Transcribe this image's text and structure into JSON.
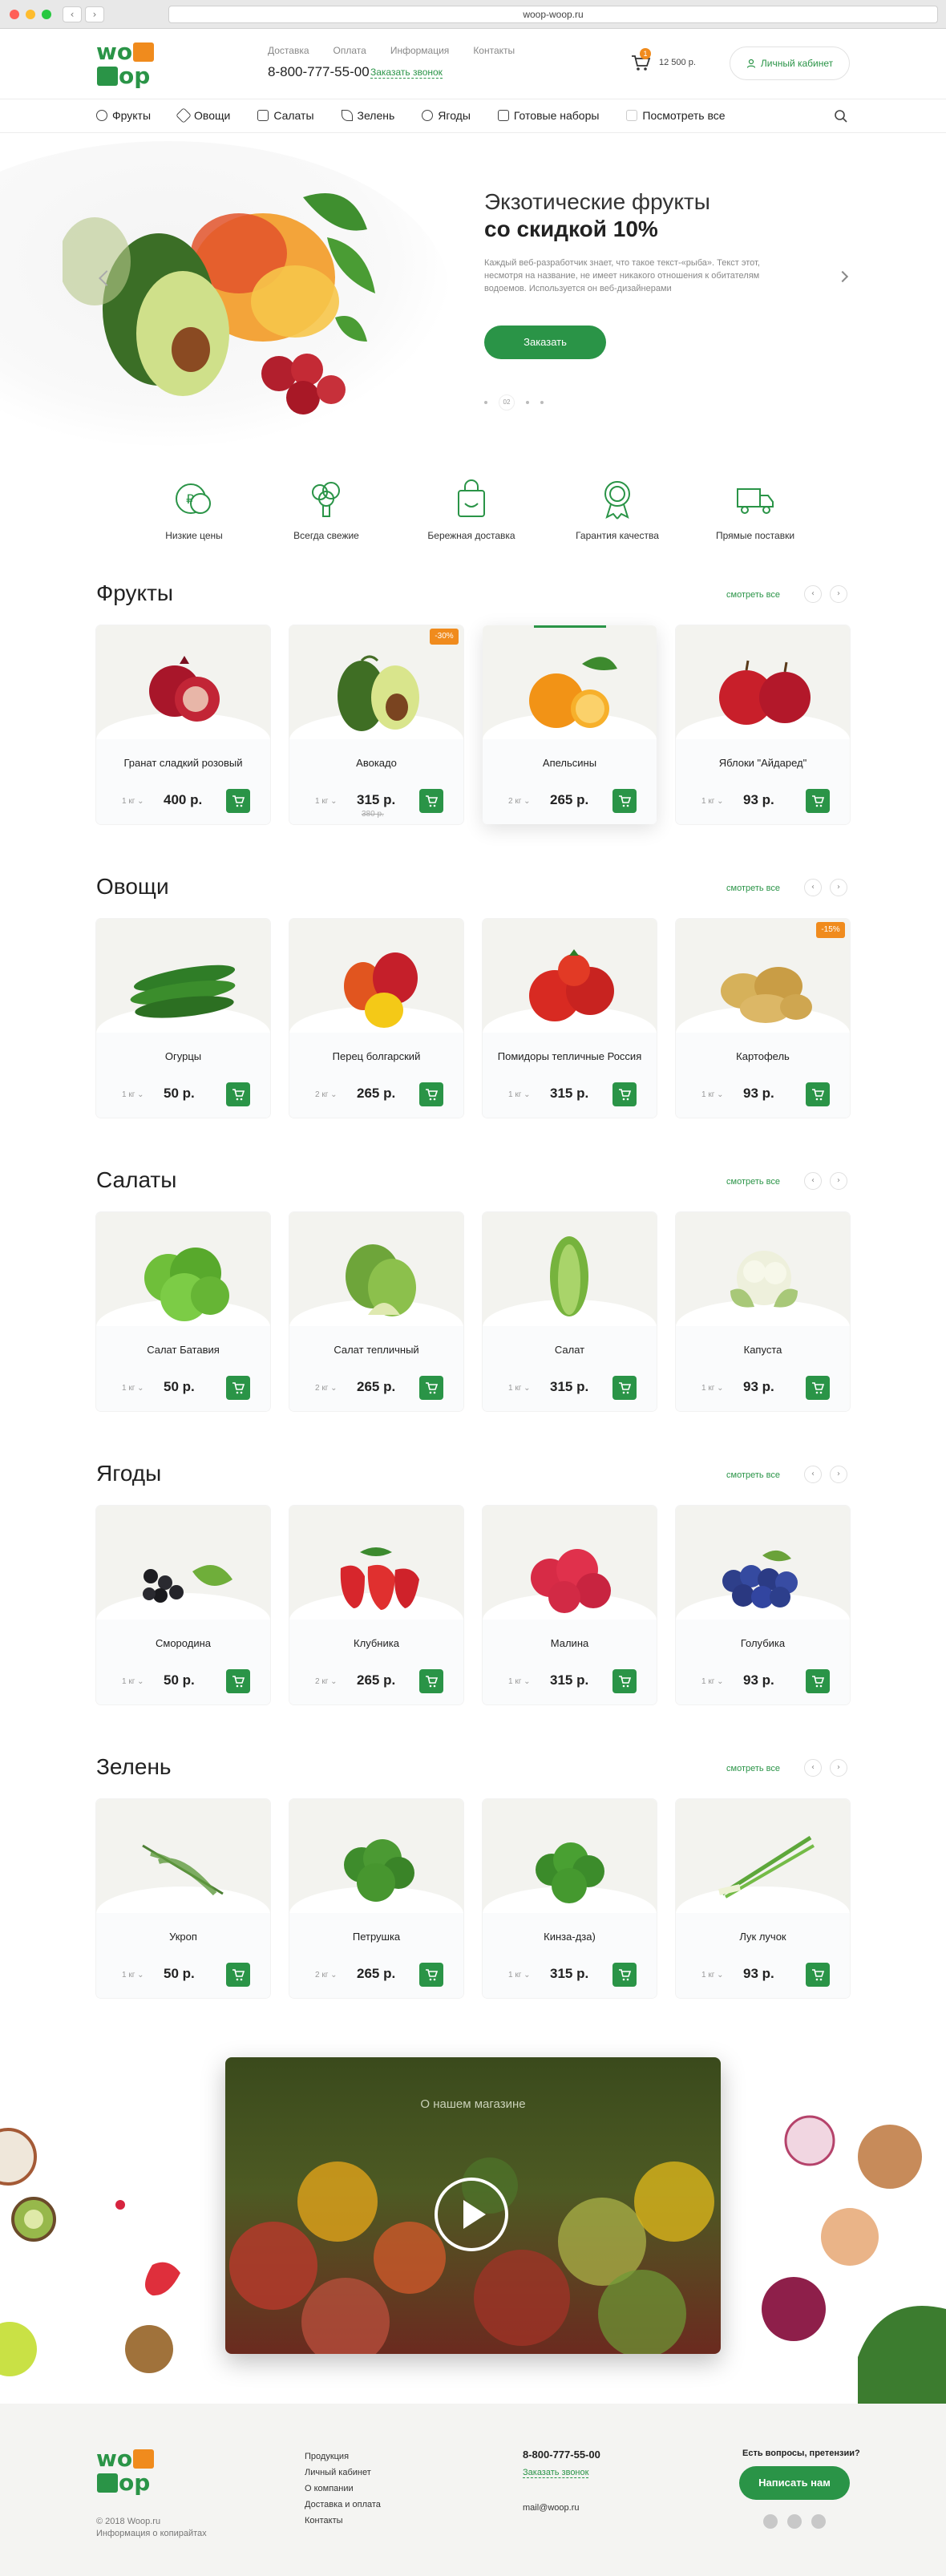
{
  "browser": {
    "url": "woop-woop.ru"
  },
  "header": {
    "logo_alt": "WOOP",
    "nav": [
      "Доставка",
      "Оплата",
      "Информация",
      "Контакты"
    ],
    "phone": "8-800-777-55-00",
    "callback": "Заказать звонок",
    "cart_count": "1",
    "cart_sum": "12 500 р.",
    "account": "Личный кабинет"
  },
  "catnav": [
    "Фрукты",
    "Овощи",
    "Салаты",
    "Зелень",
    "Ягоды",
    "Готовые наборы",
    "Посмотреть все"
  ],
  "hero": {
    "title_line1": "Экзотические фрукты",
    "title_line2": "со скидкой 10%",
    "text": "Каждый веб-разработчик знает, что такое текст-«рыба». Текст этот, несмотря на название, не имеет никакого отношения к обитателям водоемов. Используется он веб-дизайнерами",
    "button": "Заказать",
    "slide_indicator": "02"
  },
  "features": [
    "Низкие цены",
    "Всегда свежие",
    "Бережная доставка",
    "Гарантия качества",
    "Прямые поставки"
  ],
  "see_all": "смотреть все",
  "sections": [
    {
      "title": "Фрукты",
      "items": [
        {
          "name": "Гранат сладкий розовый",
          "qty": "1 кг",
          "price": "400 р.",
          "old": "",
          "badge": ""
        },
        {
          "name": "Авокадо",
          "qty": "1 кг",
          "price": "315 р.",
          "old": "380 р.",
          "badge": "-30%"
        },
        {
          "name": "Апельсины",
          "qty": "2 кг",
          "price": "265 р.",
          "old": "",
          "badge": ""
        },
        {
          "name": "Яблоки \"Айдаред\"",
          "qty": "1 кг",
          "price": "93 р.",
          "old": "",
          "badge": ""
        }
      ]
    },
    {
      "title": "Овощи",
      "items": [
        {
          "name": "Огурцы",
          "qty": "1 кг",
          "price": "50 р.",
          "old": "",
          "badge": ""
        },
        {
          "name": "Перец болгарский",
          "qty": "2 кг",
          "price": "265 р.",
          "old": "",
          "badge": ""
        },
        {
          "name": "Помидоры тепличные Россия",
          "qty": "1 кг",
          "price": "315 р.",
          "old": "",
          "badge": ""
        },
        {
          "name": "Картофель",
          "qty": "1 кг",
          "price": "93 р.",
          "old": "",
          "badge": "-15%"
        }
      ]
    },
    {
      "title": "Салаты",
      "items": [
        {
          "name": "Салат Батавия",
          "qty": "1 кг",
          "price": "50 р.",
          "old": "",
          "badge": ""
        },
        {
          "name": "Салат тепличный",
          "qty": "2 кг",
          "price": "265 р.",
          "old": "",
          "badge": ""
        },
        {
          "name": "Салат",
          "qty": "1 кг",
          "price": "315 р.",
          "old": "",
          "badge": ""
        },
        {
          "name": "Капуста",
          "qty": "1 кг",
          "price": "93 р.",
          "old": "",
          "badge": ""
        }
      ]
    },
    {
      "title": "Ягоды",
      "items": [
        {
          "name": "Смородина",
          "qty": "1 кг",
          "price": "50 р.",
          "old": "",
          "badge": ""
        },
        {
          "name": "Клубника",
          "qty": "2 кг",
          "price": "265 р.",
          "old": "",
          "badge": ""
        },
        {
          "name": "Малина",
          "qty": "1 кг",
          "price": "315 р.",
          "old": "",
          "badge": ""
        },
        {
          "name": "Голубика",
          "qty": "1 кг",
          "price": "93 р.",
          "old": "",
          "badge": ""
        }
      ]
    },
    {
      "title": "Зелень",
      "items": [
        {
          "name": "Укроп",
          "qty": "1 кг",
          "price": "50 р.",
          "old": "",
          "badge": ""
        },
        {
          "name": "Петрушка",
          "qty": "2 кг",
          "price": "265 р.",
          "old": "",
          "badge": ""
        },
        {
          "name": "Кинза-дза)",
          "qty": "1 кг",
          "price": "315 р.",
          "old": "",
          "badge": ""
        },
        {
          "name": "Лук лучок",
          "qty": "1 кг",
          "price": "93 р.",
          "old": "",
          "badge": ""
        }
      ]
    }
  ],
  "video": {
    "title": "О нашем магазине"
  },
  "footer": {
    "menu": [
      "Продукция",
      "Личный кабинет",
      "О компании",
      "Доставка и оплата",
      "Контакты"
    ],
    "phone": "8-800-777-55-00",
    "callback": "Заказать звонок",
    "email": "mail@woop.ru",
    "question": "Есть вопросы, претензии?",
    "button": "Написать нам",
    "copyright": "© 2018 Woop.ru",
    "copyright_info": "Информация о копирайтах"
  },
  "colors": {
    "accent": "#2a9447",
    "orange": "#f08b1d"
  }
}
